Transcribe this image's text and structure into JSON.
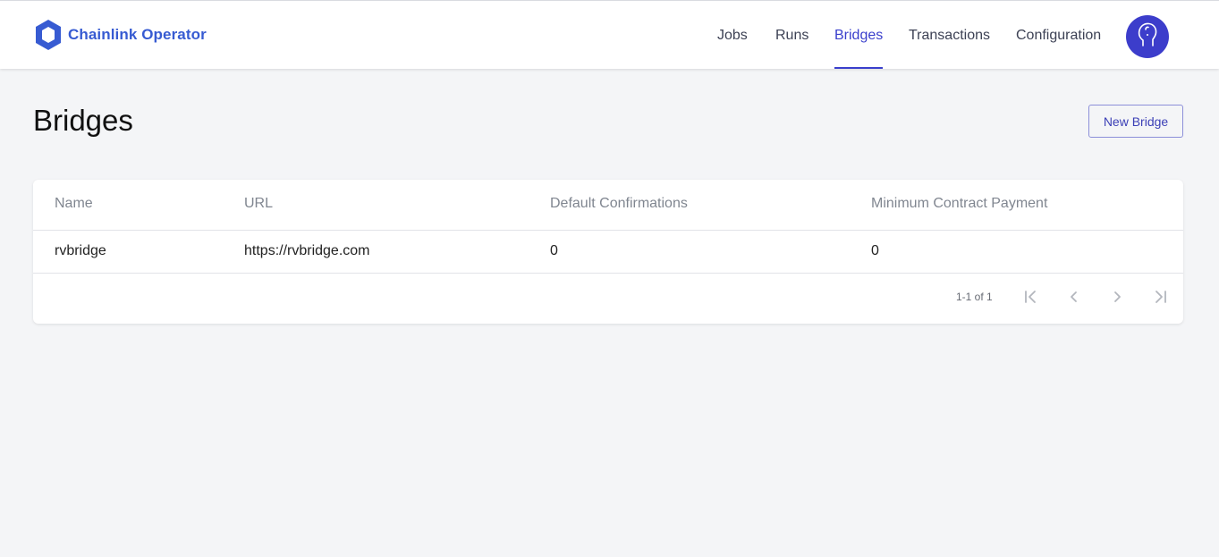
{
  "app": {
    "brand_name": "Chainlink Operator",
    "accent_color": "#375bd2",
    "nav_active_color": "#3a3fcc"
  },
  "nav": {
    "items": [
      {
        "label": "Jobs",
        "active": false
      },
      {
        "label": "Runs",
        "active": false
      },
      {
        "label": "Bridges",
        "active": true
      },
      {
        "label": "Transactions",
        "active": false
      },
      {
        "label": "Configuration",
        "active": false
      }
    ],
    "avatar_icon": "user-head-icon"
  },
  "page": {
    "title": "Bridges",
    "new_button_label": "New Bridge"
  },
  "table": {
    "columns": [
      "Name",
      "URL",
      "Default Confirmations",
      "Minimum Contract Payment"
    ],
    "rows": [
      [
        "rvbridge",
        "https://rvbridge.com",
        "0",
        "0"
      ]
    ],
    "pagination": {
      "label": "1-1 of 1",
      "icons": [
        "first-page-icon",
        "prev-page-icon",
        "next-page-icon",
        "last-page-icon"
      ]
    }
  }
}
